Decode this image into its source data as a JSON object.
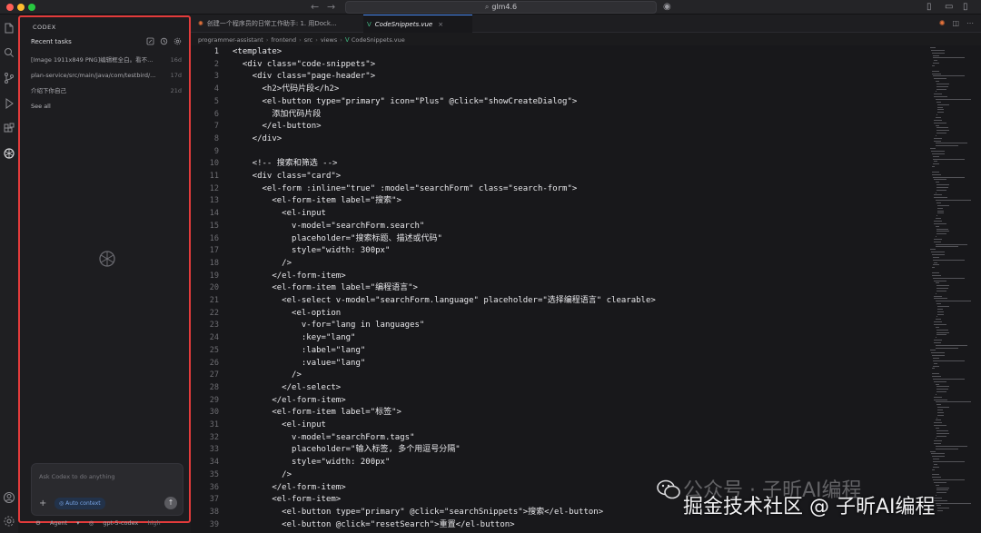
{
  "window": {
    "search_text": "glm4.6"
  },
  "activity_bar": {
    "icons": [
      "files-icon",
      "search-icon",
      "source-control-icon",
      "run-debug-icon",
      "extensions-icon",
      "codex-icon",
      "account-icon",
      "settings-icon"
    ]
  },
  "codex_panel": {
    "title": "CODEX",
    "recent_tasks_title": "Recent tasks",
    "tasks": [
      {
        "label": "[Image 1911x849 PNG]编辑框全白。看不...",
        "age": "16d"
      },
      {
        "label": "plan-service/src/main/java/com/testbird/...",
        "age": "17d"
      },
      {
        "label": "介绍下你自己",
        "age": "21d"
      }
    ],
    "see_all": "See all",
    "input_placeholder": "Ask Codex to do anything",
    "plus": "+",
    "auto_context": "Auto context",
    "mode": "Agent",
    "model": "gpt-5-codex",
    "effort": "high"
  },
  "tabs": [
    {
      "label": "创建一个程序员的日常工作助手: 1. 用Dock...",
      "active": false
    },
    {
      "label": "CodeSnippets.vue",
      "active": true
    }
  ],
  "breadcrumb": [
    "programmer-assistant",
    "frontend",
    "src",
    "views",
    "CodeSnippets.vue"
  ],
  "code": {
    "active_line": 1,
    "lines": [
      "<template>",
      "  <div class=\"code-snippets\">",
      "    <div class=\"page-header\">",
      "      <h2>代码片段</h2>",
      "      <el-button type=\"primary\" icon=\"Plus\" @click=\"showCreateDialog\">",
      "        添加代码片段",
      "      </el-button>",
      "    </div>",
      "",
      "    <!-- 搜索和筛选 -->",
      "    <div class=\"card\">",
      "      <el-form :inline=\"true\" :model=\"searchForm\" class=\"search-form\">",
      "        <el-form-item label=\"搜索\">",
      "          <el-input",
      "            v-model=\"searchForm.search\"",
      "            placeholder=\"搜索标题、描述或代码\"",
      "            style=\"width: 300px\"",
      "          />",
      "        </el-form-item>",
      "        <el-form-item label=\"编程语言\">",
      "          <el-select v-model=\"searchForm.language\" placeholder=\"选择编程语言\" clearable>",
      "            <el-option",
      "              v-for=\"lang in languages\"",
      "              :key=\"lang\"",
      "              :label=\"lang\"",
      "              :value=\"lang\"",
      "            />",
      "          </el-select>",
      "        </el-form-item>",
      "        <el-form-item label=\"标签\">",
      "          <el-input",
      "            v-model=\"searchForm.tags\"",
      "            placeholder=\"输入标签, 多个用逗号分隔\"",
      "            style=\"width: 200px\"",
      "          />",
      "        </el-form-item>",
      "        <el-form-item>",
      "          <el-button type=\"primary\" @click=\"searchSnippets\">搜索</el-button>",
      "          <el-button @click=\"resetSearch\">重置</el-button>"
    ]
  },
  "watermark": {
    "top": "公众号 · 子昕AI编程",
    "bottom": "掘金技术社区 @ 子昕AI编程"
  },
  "colors": {
    "highlight_border": "#e33b3b",
    "accent": "#4d8ef7",
    "vue": "#42b883"
  }
}
